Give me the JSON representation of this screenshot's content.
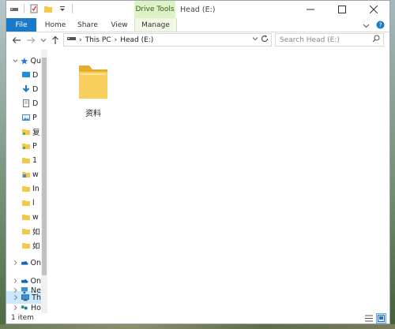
{
  "window": {
    "title": "Head (E:)",
    "contextual_tab_label": "Drive Tools"
  },
  "ribbon": {
    "tabs": [
      {
        "label": "File"
      },
      {
        "label": "Home"
      },
      {
        "label": "Share"
      },
      {
        "label": "View"
      },
      {
        "label": "Manage"
      }
    ]
  },
  "address_bar": {
    "crumbs": [
      "This PC",
      "Head (E:)"
    ]
  },
  "search": {
    "placeholder": "Search Head (E:)"
  },
  "sidebar": {
    "items": [
      {
        "label": "Qu",
        "icon": "star-icon"
      },
      {
        "label": "D",
        "icon": "desktop-icon"
      },
      {
        "label": "D",
        "icon": "download-icon"
      },
      {
        "label": "D",
        "icon": "documents-icon"
      },
      {
        "label": "P",
        "icon": "pictures-icon"
      },
      {
        "label": "复",
        "icon": "folder-icon"
      },
      {
        "label": "P",
        "icon": "folder-icon"
      },
      {
        "label": "1",
        "icon": "folder-icon"
      },
      {
        "label": "w",
        "icon": "folder-icon"
      },
      {
        "label": "In",
        "icon": "folder-icon"
      },
      {
        "label": "l",
        "icon": "folder-icon"
      },
      {
        "label": "w",
        "icon": "folder-icon"
      },
      {
        "label": "如",
        "icon": "folder-icon"
      },
      {
        "label": "如",
        "icon": "folder-icon"
      },
      {
        "label": "On",
        "icon": "onedrive-icon"
      },
      {
        "label": "On",
        "icon": "onedrive-icon"
      },
      {
        "label": "Th",
        "icon": "this-pc-icon"
      },
      {
        "label": "Ne",
        "icon": "network-icon"
      },
      {
        "label": "Ho",
        "icon": "homegroup-icon"
      }
    ]
  },
  "content": {
    "items": [
      {
        "name": "资料"
      }
    ]
  },
  "status_bar": {
    "item_count": "1 item"
  },
  "colors": {
    "accent": "#1979ca",
    "contextual": "#dff2c6",
    "selection": "#cce8ff",
    "folder": "#f5c84c"
  }
}
